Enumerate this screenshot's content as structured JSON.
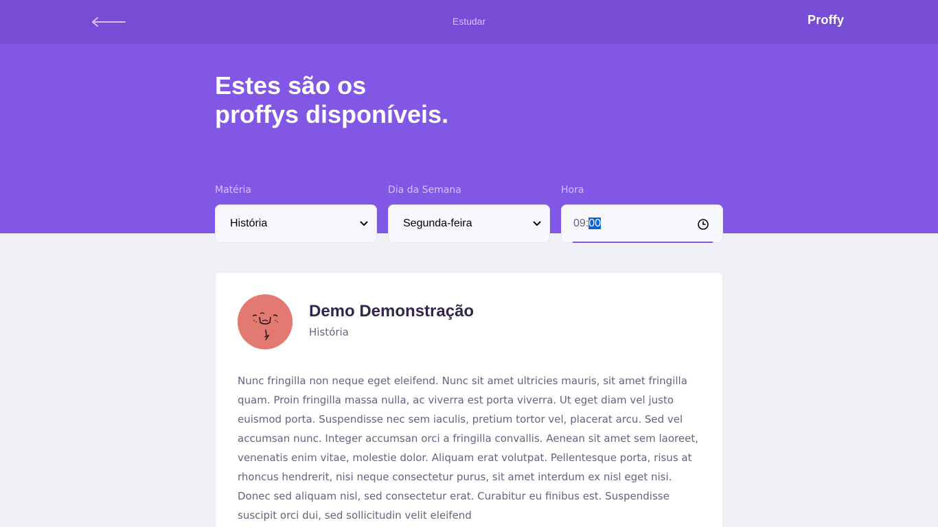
{
  "header": {
    "title": "Estudar",
    "logo": "Proffy",
    "back_icon": "arrow-left-icon"
  },
  "hero": {
    "title_line1": "Estes são os",
    "title_line2": "proffys disponíveis."
  },
  "filters": {
    "subject": {
      "label": "Matéria",
      "value": "História"
    },
    "weekday": {
      "label": "Dia da Semana",
      "value": "Segunda-feira"
    },
    "time": {
      "label": "Hora",
      "hours": "09",
      "separator": ":",
      "minutes": "00"
    }
  },
  "teacher": {
    "name": "Demo Demonstração",
    "subject": "História",
    "bio": "Nunc fringilla non neque eget eleifend. Nunc sit amet ultricies mauris, sit amet fringilla quam. Proin fringilla massa nulla, ac viverra est porta viverra. Ut eget diam vel justo euismod porta. Suspendisse nec sem iaculis, pretium tortor vel, placerat arcu. Sed vel accumsan nunc. Integer accumsan orci a fringilla convallis. Aenean sit amet sem laoreet, venenatis enim vitae, molestie dolor. Aliquam erat volutpat. Pellentesque porta, risus at rhoncus hendrerit, nisi neque consectetur purus, sit amet interdum ex nisl eget nisi. Donec sed aliquam nisl, sed consectetur erat. Curabitur eu finibus est. Suspendisse suscipit orci dui, sed sollicitudin velit eleifend"
  },
  "colors": {
    "topbar": "#774DD6",
    "primary": "#8257E5",
    "background": "#F0F0F7",
    "avatar": "#E37A72"
  }
}
